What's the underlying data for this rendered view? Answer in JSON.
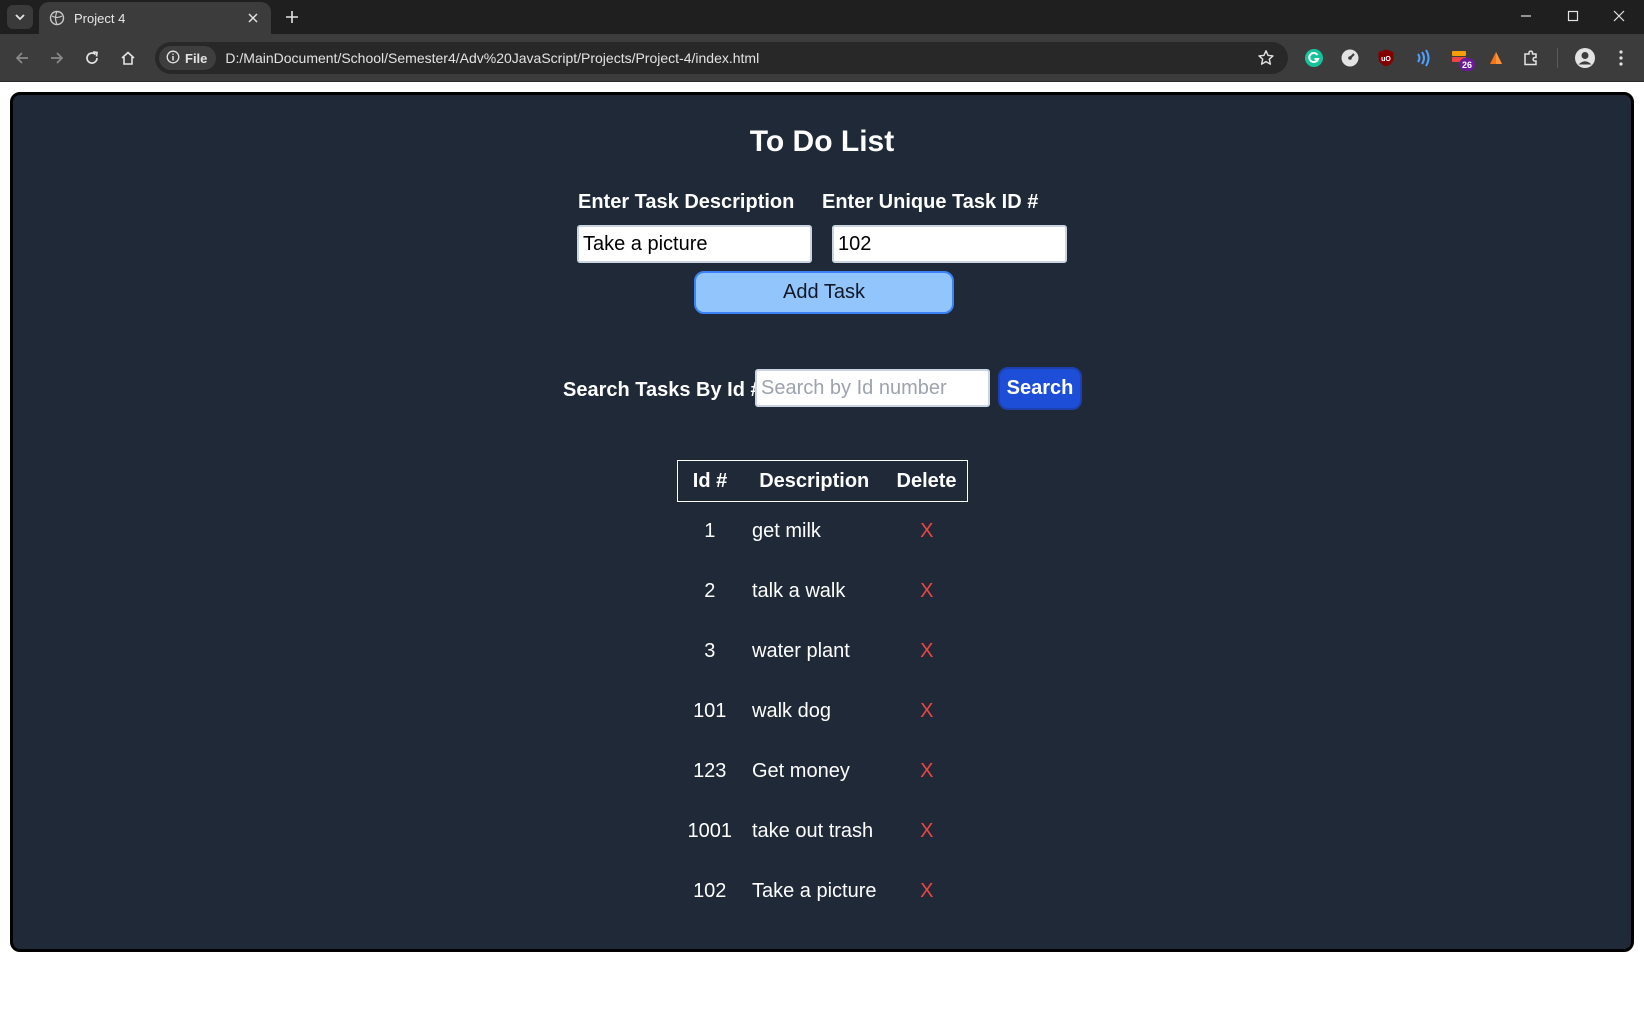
{
  "browser": {
    "tab_title": "Project 4",
    "site_chip_label": "File",
    "url": "D:/MainDocument/School/Semester4/Adv%20JavaScript/Projects/Project-4/index.html",
    "extension_badge": "26"
  },
  "page": {
    "title": "To Do List",
    "description_label": "Enter Task Description",
    "id_label": "Enter Unique Task ID #",
    "description_value": "Take a picture",
    "id_value": "102",
    "add_button": "Add Task",
    "search_label": "Search Tasks By Id #",
    "search_placeholder": "Search by Id number",
    "search_button": "Search"
  },
  "table": {
    "headers": {
      "id": "Id #",
      "description": "Description",
      "delete": "Delete"
    },
    "rows": [
      {
        "id": "1",
        "description": "get milk",
        "delete": "X"
      },
      {
        "id": "2",
        "description": "talk a walk",
        "delete": "X"
      },
      {
        "id": "3",
        "description": "water plant",
        "delete": "X"
      },
      {
        "id": "101",
        "description": "walk dog",
        "delete": "X"
      },
      {
        "id": "123",
        "description": "Get money",
        "delete": "X"
      },
      {
        "id": "1001",
        "description": "take out trash",
        "delete": "X"
      },
      {
        "id": "102",
        "description": "Take a picture",
        "delete": "X"
      }
    ]
  },
  "colors": {
    "card_background": "#1f2937",
    "add_button": "#93c5fd",
    "search_button": "#1d4ed8",
    "delete_x": "#ef4444"
  }
}
